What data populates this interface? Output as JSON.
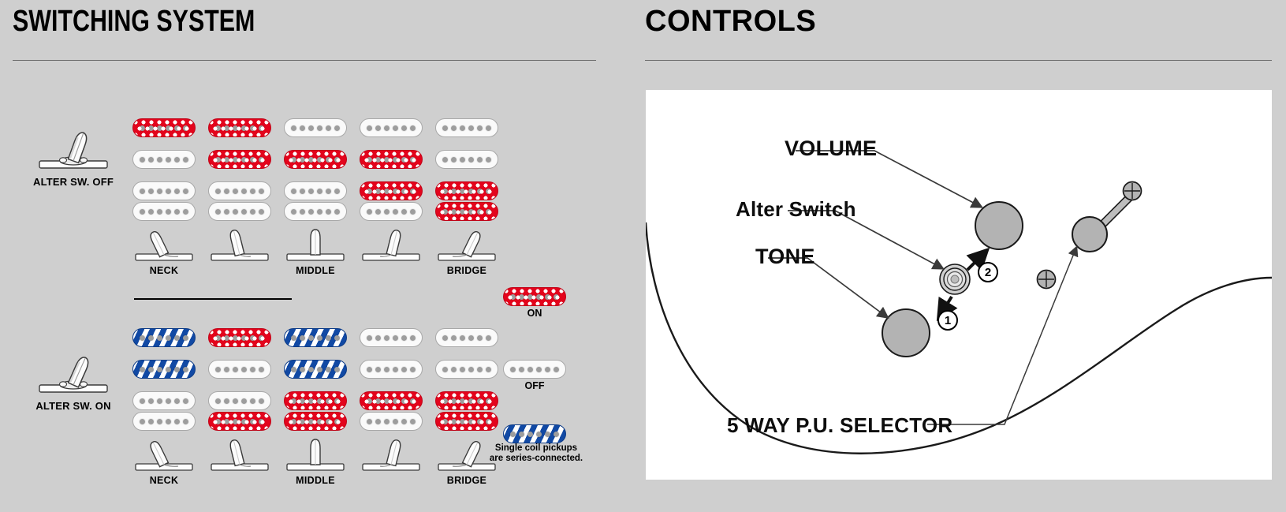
{
  "panels": {
    "switching": {
      "title": "SWITCHING SYSTEM",
      "alter_off_label": "ALTER SW. OFF",
      "alter_on_label": "ALTER SW. ON",
      "position_labels": [
        "NECK",
        "MIDDLE",
        "BRIDGE"
      ],
      "legend": {
        "on_label": "ON",
        "off_label": "OFF",
        "note_line1": "Single coil pickups",
        "note_line2": "are series-connected."
      },
      "colors": {
        "on": "#e3041c",
        "off": "#fafafa",
        "series": "#1149a4",
        "pole": "#9d9d9d",
        "background": "#cfcfcf",
        "rule": "#6b6b6b"
      },
      "matrix_off": {
        "caption": "ALTER SW. OFF",
        "rows": [
          {
            "type": "single",
            "states": [
              "on",
              "on",
              "off",
              "off",
              "off"
            ]
          },
          {
            "type": "single",
            "states": [
              "off",
              "on",
              "on",
              "on",
              "off"
            ]
          },
          {
            "type": "humbucker",
            "states": [
              [
                "off",
                "off"
              ],
              [
                "off",
                "off"
              ],
              [
                "off",
                "off"
              ],
              [
                "on",
                "off"
              ],
              [
                "on",
                "on"
              ]
            ]
          }
        ]
      },
      "matrix_on": {
        "caption": "ALTER SW. ON",
        "rows": [
          {
            "type": "single",
            "states": [
              "series",
              "on",
              "series",
              "off",
              "off"
            ]
          },
          {
            "type": "single",
            "states": [
              "series",
              "off",
              "series",
              "off",
              "off"
            ]
          },
          {
            "type": "humbucker",
            "states": [
              [
                "off",
                "off"
              ],
              [
                "off",
                "on"
              ],
              [
                "on",
                "on"
              ],
              [
                "on",
                "off"
              ],
              [
                "on",
                "on"
              ]
            ]
          }
        ]
      }
    },
    "controls": {
      "title": "CONTROLS",
      "labels": {
        "volume": "VOLUME",
        "alter_switch": "Alter Switch",
        "tone": "TONE",
        "selector": "5 WAY P.U. SELECTOR"
      },
      "badges": [
        "1",
        "2"
      ],
      "colors": {
        "card": "#ffffff",
        "knob": "#b3b3b3",
        "outline": "#1a1a1a"
      }
    }
  }
}
